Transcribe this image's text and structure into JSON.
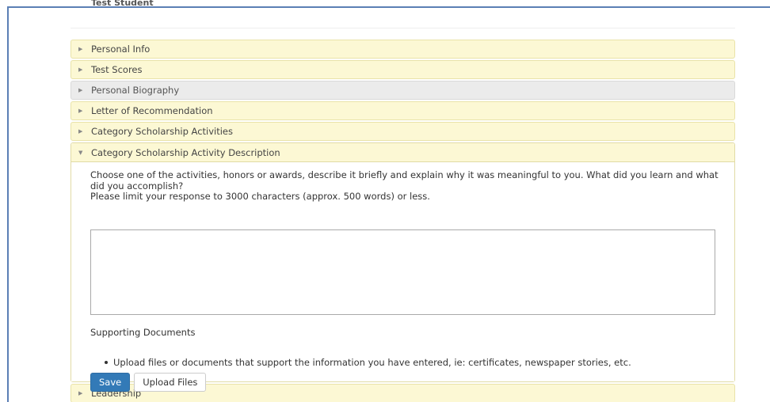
{
  "student": {
    "name": "Test Student"
  },
  "accordion": {
    "sections": [
      {
        "label": "Personal Info",
        "state": "collapsed",
        "style": "yellow"
      },
      {
        "label": "Test Scores",
        "state": "collapsed",
        "style": "yellow"
      },
      {
        "label": "Personal Biography",
        "state": "collapsed",
        "style": "gray"
      },
      {
        "label": "Letter of Recommendation",
        "state": "collapsed",
        "style": "yellow"
      },
      {
        "label": "Category Scholarship Activities",
        "state": "collapsed",
        "style": "yellow"
      },
      {
        "label": "Category Scholarship Activity Description",
        "state": "expanded",
        "style": "yellow"
      },
      {
        "label": "Leadership",
        "state": "collapsed",
        "style": "yellow"
      }
    ],
    "icons": {
      "collapsed": "caret-right-icon",
      "expanded": "caret-down-icon"
    }
  },
  "activity_description": {
    "prompt_line1": "Choose one of the activities, honors or awards, describe it briefly and explain why it was meaningful to you. What did you learn and what did you accomplish?",
    "prompt_line2": "Please limit your response to 3000 characters (approx. 500 words) or less.",
    "response_value": "",
    "supporting_label": "Supporting Documents",
    "supporting_bullet": "Upload files or documents that support the information you have entered, ie: certificates, newspaper stories, etc.",
    "save_label": "Save",
    "upload_label": "Upload Files"
  },
  "colors": {
    "panel_yellow": "#fcf8d4",
    "panel_gray": "#ebebeb",
    "primary_button": "#337ab7",
    "frame_border": "#5b7fb5"
  }
}
